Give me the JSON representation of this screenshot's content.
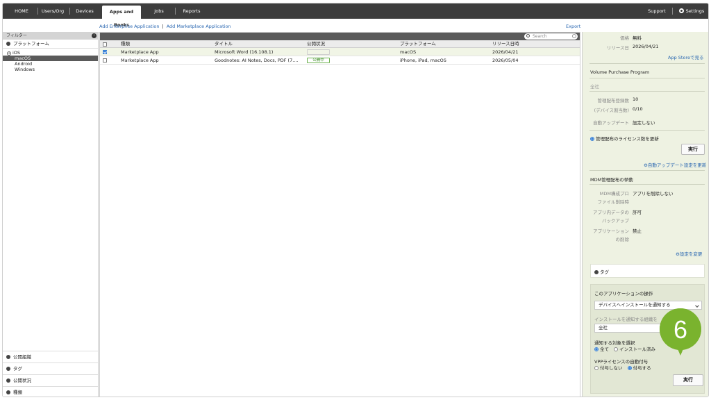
{
  "nav": {
    "items": [
      "HOME",
      "Users/Org",
      "Devices",
      "Apps and Books",
      "Jobs",
      "Reports"
    ],
    "support": "Support",
    "settings": "Settings"
  },
  "actions": {
    "add_enterprise": "Add Enterprise Application",
    "separator": "|",
    "add_marketplace": "Add Marketplace Application",
    "export": "Export"
  },
  "sidebar": {
    "filter_label": "フィルター",
    "platform_label": "プラットフォーム",
    "tree_root": "iOS",
    "tree_children": [
      "macOS",
      "Android",
      "Windows"
    ],
    "bottom_sections": [
      "公開組織",
      "タグ",
      "公開状況",
      "種類"
    ]
  },
  "search": {
    "placeholder": "Search"
  },
  "table": {
    "headers": [
      "種類",
      "タイトル",
      "公開状況",
      "プラットフォーム",
      "リリース日時"
    ],
    "rows": [
      {
        "type": "Marketplace App",
        "title": "Microsoft Word (16.108.1)",
        "status": "",
        "platform": "macOS",
        "release": "2026/04/21",
        "checked": true
      },
      {
        "type": "Marketplace App",
        "title": "Goodnotes: AI Notes, Docs, PDF (7....",
        "status": "公開中",
        "platform": "iPhone, iPad, macOS",
        "release": "2026/05/04",
        "checked": false
      }
    ]
  },
  "details": {
    "price_k": "価格",
    "price_v": "無料",
    "release_k": "リリース日",
    "release_v": "2026/04/21",
    "appstore_link": "App Storeで見る",
    "vpp_title": "Volume Purchase Program",
    "vpp_scope": "全社",
    "licenses_k": "管理配布登録数",
    "licenses_v": "10",
    "device_count_k": "(デバイス割当数)",
    "device_count_v": "0/10",
    "autoupdate_k": "自動アップデート",
    "autoupdate_v": "設定しない",
    "license_update_radio": "管理配布のライセンス数を更新",
    "run_button": "実行",
    "autoupdate_link": "自動アップデート設定を更新",
    "mdm_title": "MDM管理配布の挙動",
    "remove_profile_k1": "MDM構成プロ",
    "remove_profile_k2": "ファイル削除時",
    "remove_profile_v": "アプリを削除しない",
    "backup_k1": "アプリ内データの",
    "backup_k2": "バックアップ",
    "backup_v": "許可",
    "delete_k1": "アプリケーション",
    "delete_k2": "の削除",
    "delete_v": "禁止",
    "change_settings_link": "設定を変更",
    "tag_label": "タグ"
  },
  "operations": {
    "title": "このアプリケーションの操作",
    "action_select": "デバイスへインストールを通知する",
    "org_label": "インストールを通知する組織を",
    "org_select": "全社",
    "target_label": "通知する対象を選択",
    "target_all": "全て",
    "target_installed": "インストール済み",
    "vpp_label": "VPPライセンスの自動付与",
    "vpp_no": "付与しない",
    "vpp_yes": "付与する",
    "run_button": "実行"
  },
  "callout": {
    "number": "6",
    "color": "#7ab32e"
  }
}
